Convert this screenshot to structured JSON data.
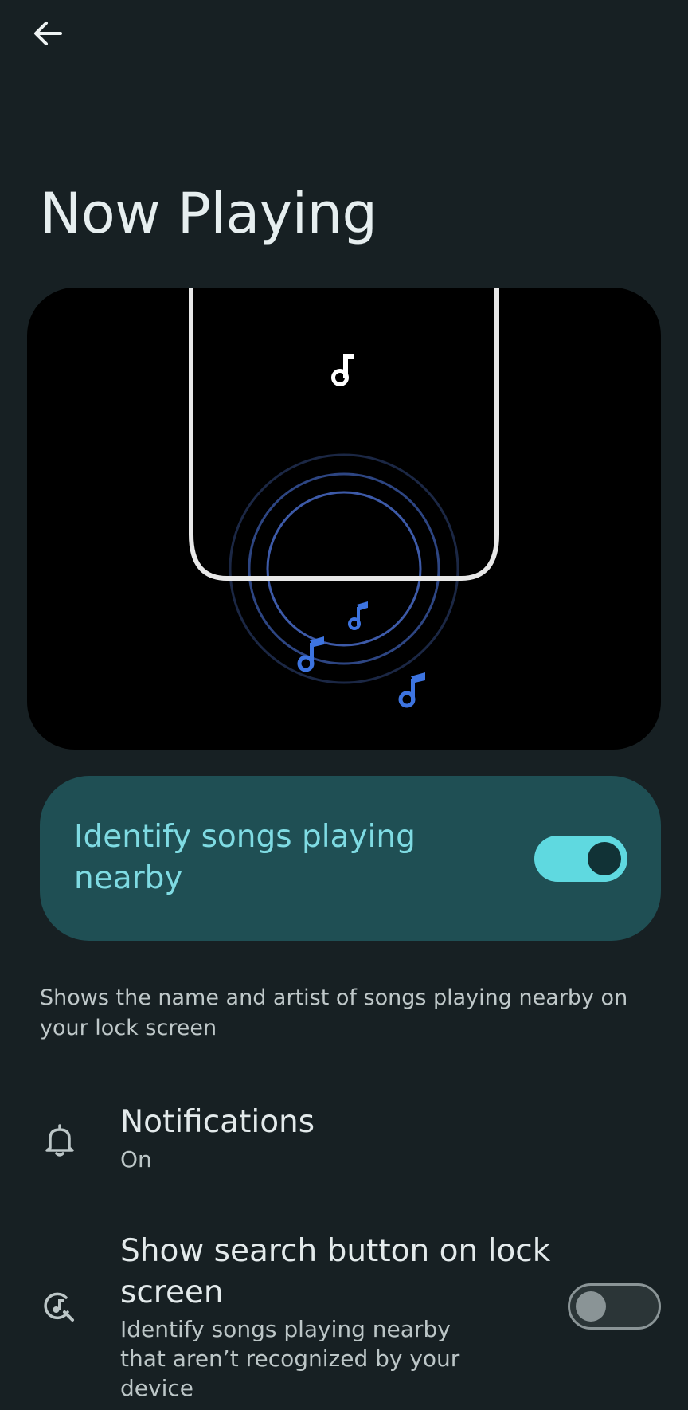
{
  "header": {
    "back_icon": "arrow-back-icon",
    "title": "Now Playing"
  },
  "illustration": {
    "icons": [
      "music-note-icon"
    ],
    "colors": {
      "background": "#000000",
      "phone_outline": "#e8e8e8",
      "rings": "#3d5aa8",
      "notes_blue": "#3d74e0",
      "note_white": "#ffffff"
    }
  },
  "main_switch": {
    "label": "Identify songs playing nearby",
    "checked": true,
    "colors": {
      "card": "#1f4f54",
      "label": "#7fdbe3",
      "track": "#5fd9e0",
      "thumb": "#113236"
    }
  },
  "description": "Shows the name and artist of songs playing nearby on your lock screen",
  "settings": [
    {
      "icon": "bell-icon",
      "title": "Notifications",
      "subtitle": "On"
    },
    {
      "icon": "music-search-icon",
      "title": "Show search button on lock screen",
      "subtitle": "Identify songs playing nearby that aren’t recognized by your device",
      "toggle_checked": false
    }
  ],
  "colors": {
    "page_background": "#172023"
  }
}
